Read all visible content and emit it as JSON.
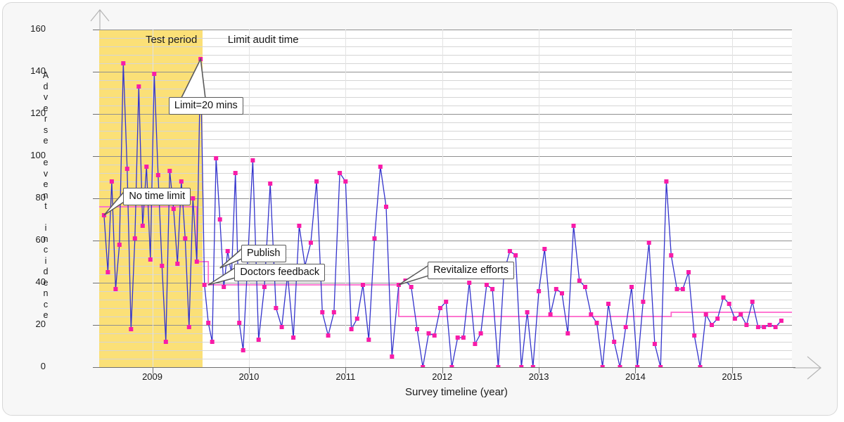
{
  "chart_data": {
    "type": "line",
    "title": "",
    "xlabel": "Survey timeline (year)",
    "ylabel": "Adverse event incidence",
    "ylabel_chars": [
      "A",
      "d",
      "v",
      "e",
      "r",
      "s",
      "e",
      "",
      "e",
      "v",
      "e",
      "n",
      "t",
      "",
      "i",
      "n",
      "c",
      "i",
      "d",
      "e",
      "n",
      "c",
      "e"
    ],
    "ylim": [
      0,
      160
    ],
    "yticks": [
      0,
      20,
      40,
      60,
      80,
      100,
      120,
      140,
      160
    ],
    "xlim": [
      2008.45,
      2015.62
    ],
    "xticks": [
      2009,
      2010,
      2011,
      2012,
      2013,
      2014,
      2015
    ],
    "xticklabels": [
      "2009",
      "2010",
      "2011",
      "2012",
      "2013",
      "2014",
      "2015"
    ],
    "grid": "horizontal minor every 4, major every 20",
    "legend": "none",
    "colors": {
      "line": "#3333cc",
      "marker": "#f81ca8",
      "mean_line": "#ff66cc",
      "band": "#fbe077",
      "gridline_minor": "#d5d5d5",
      "gridline_major": "#909090",
      "axis": "#707070",
      "callout_border": "#5a5a5a",
      "background": "#f7f7f7",
      "plot_background": "#ffffff"
    },
    "shaded_region": {
      "label": "Test period",
      "x_start": 2008.45,
      "x_end": 2009.52
    },
    "section_labels": [
      {
        "text": "Test period",
        "x": 2008.93,
        "y": 155
      },
      {
        "text": "Limit audit time",
        "x": 2009.78,
        "y": 155
      }
    ],
    "annotations": [
      {
        "text": "Limit=20 mins",
        "point_x": 2009.5,
        "point_y": 146,
        "box_x": 2009.17,
        "box_y": 128
      },
      {
        "text": "No time limit",
        "point_x": 2008.5,
        "point_y": 72,
        "box_x": 2008.7,
        "box_y": 85
      },
      {
        "text": "Publish",
        "point_x": 2009.7,
        "point_y": 47,
        "box_x": 2009.92,
        "box_y": 58
      },
      {
        "text": "Doctors feedback",
        "point_x": 2009.58,
        "point_y": 39,
        "box_x": 2009.85,
        "box_y": 49
      },
      {
        "text": "Revitalize efforts",
        "point_x": 2011.55,
        "point_y": 39,
        "box_x": 2011.85,
        "box_y": 50
      }
    ],
    "mean_line": {
      "name": "Segment mean",
      "segments": [
        {
          "x_start": 2008.45,
          "x_end": 2009.46,
          "value": 76
        },
        {
          "x_start": 2009.46,
          "x_end": 2009.58,
          "value": 50
        },
        {
          "x_start": 2009.58,
          "x_end": 2011.55,
          "value": 39
        },
        {
          "x_start": 2011.55,
          "x_end": 2014.37,
          "value": 24
        },
        {
          "x_start": 2014.37,
          "x_end": 2015.62,
          "value": 26
        }
      ]
    },
    "x": [
      2008.5,
      2008.54,
      2008.58,
      2008.62,
      2008.66,
      2008.7,
      2008.74,
      2008.78,
      2008.82,
      2008.86,
      2008.9,
      2008.94,
      2008.98,
      2009.02,
      2009.06,
      2009.1,
      2009.14,
      2009.18,
      2009.22,
      2009.26,
      2009.3,
      2009.34,
      2009.38,
      2009.42,
      2009.46,
      2009.5,
      2009.54,
      2009.58,
      2009.62,
      2009.66,
      2009.7,
      2009.74,
      2009.78,
      2009.82,
      2009.86,
      2009.9,
      2009.94,
      2009.98,
      2010.04,
      2010.1,
      2010.16,
      2010.22,
      2010.28,
      2010.34,
      2010.4,
      2010.46,
      2010.52,
      2010.58,
      2010.64,
      2010.7,
      2010.76,
      2010.82,
      2010.88,
      2010.94,
      2011.0,
      2011.06,
      2011.12,
      2011.18,
      2011.24,
      2011.3,
      2011.36,
      2011.42,
      2011.48,
      2011.55,
      2011.62,
      2011.68,
      2011.74,
      2011.8,
      2011.86,
      2011.92,
      2011.98,
      2012.04,
      2012.1,
      2012.16,
      2012.22,
      2012.28,
      2012.34,
      2012.4,
      2012.46,
      2012.52,
      2012.58,
      2012.64,
      2012.7,
      2012.76,
      2012.82,
      2012.88,
      2012.94,
      2013.0,
      2013.06,
      2013.12,
      2013.18,
      2013.24,
      2013.3,
      2013.36,
      2013.42,
      2013.48,
      2013.54,
      2013.6,
      2013.66,
      2013.72,
      2013.78,
      2013.84,
      2013.9,
      2013.96,
      2014.02,
      2014.08,
      2014.14,
      2014.2,
      2014.26,
      2014.32,
      2014.37,
      2014.43,
      2014.49,
      2014.55,
      2014.61,
      2014.67,
      2014.73,
      2014.79,
      2014.85,
      2014.91,
      2014.97,
      2015.03,
      2015.09,
      2015.15,
      2015.21,
      2015.27,
      2015.33,
      2015.39,
      2015.45,
      2015.51
    ],
    "y": [
      72,
      45,
      88,
      37,
      58,
      144,
      94,
      18,
      61,
      133,
      67,
      95,
      51,
      139,
      91,
      48,
      12,
      93,
      75,
      49,
      88,
      61,
      19,
      80,
      50,
      146,
      39,
      21,
      12,
      99,
      70,
      38,
      55,
      44,
      92,
      21,
      8,
      44,
      98,
      13,
      38,
      87,
      28,
      19,
      44,
      14,
      67,
      48,
      59,
      88,
      26,
      15,
      26,
      92,
      88,
      18,
      23,
      39,
      13,
      61,
      95,
      76,
      5,
      39,
      41,
      38,
      18,
      0,
      16,
      15,
      28,
      31,
      0,
      14,
      14,
      40,
      11,
      16,
      39,
      37,
      0,
      45,
      55,
      53,
      0,
      26,
      0,
      36,
      56,
      25,
      37,
      35,
      16,
      67,
      41,
      38,
      25,
      21,
      0,
      30,
      12,
      0,
      19,
      38,
      0,
      31,
      59,
      11,
      0,
      88,
      53,
      37,
      37,
      45,
      15,
      0,
      25,
      20,
      23,
      33,
      30,
      23,
      25,
      20,
      31,
      19,
      19,
      20,
      19,
      22
    ]
  }
}
